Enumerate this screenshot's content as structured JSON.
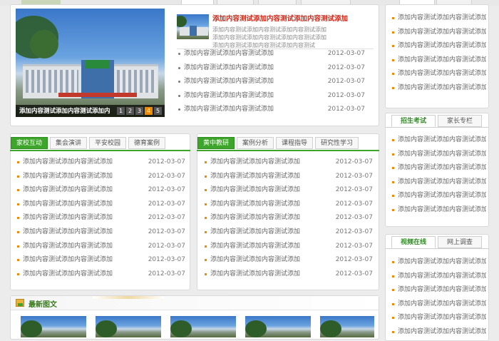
{
  "top_banner": {
    "tabs_left": [
      "",
      ""
    ],
    "tabs_mid": [
      "",
      "",
      "",
      ""
    ],
    "tabs_right": [
      "",
      ""
    ]
  },
  "news": {
    "slide_caption": "添加内容测试添加内容测试添加内",
    "slide_pages": [
      "1",
      "2",
      "3",
      "4",
      "5"
    ],
    "active_page": "4",
    "headline": "添加内容测试添加内容测试添加内容测试添加",
    "summary": [
      "添加内容测试添加内容测试添加内容测试添加",
      "添加内容测试添加内容测试添加内容测试添加",
      "添加内容测试添加内容测试添加内容测试"
    ],
    "items": [
      {
        "text": "添加内容测试添加内容测试添加",
        "date": "2012-03-07"
      },
      {
        "text": "添加内容测试添加内容测试添加",
        "date": "2012-03-07"
      },
      {
        "text": "添加内容测试添加内容测试添加",
        "date": "2012-03-07"
      },
      {
        "text": "添加内容测试添加内容测试添加",
        "date": "2012-03-07"
      },
      {
        "text": "添加内容测试添加内容测试添加",
        "date": "2012-03-07"
      }
    ]
  },
  "home_school": {
    "tabs": [
      "家校互动",
      "集会演讲",
      "平安校园",
      "德育案例"
    ],
    "items": [
      {
        "text": "添加内容测试添加内容测试添加",
        "date": "2012-03-07"
      },
      {
        "text": "添加内容测试添加内容测试添加",
        "date": "2012-03-07"
      },
      {
        "text": "添加内容测试添加内容测试添加",
        "date": "2012-03-07"
      },
      {
        "text": "添加内容测试添加内容测试添加",
        "date": "2012-03-07"
      },
      {
        "text": "添加内容测试添加内容测试添加",
        "date": "2012-03-07"
      },
      {
        "text": "添加内容测试添加内容测试添加",
        "date": "2012-03-07"
      },
      {
        "text": "添加内容测试添加内容测试添加",
        "date": "2012-03-07"
      },
      {
        "text": "添加内容测试添加内容测试添加",
        "date": "2012-03-07"
      },
      {
        "text": "添加内容测试添加内容测试添加",
        "date": "2012-03-07"
      }
    ]
  },
  "teaching": {
    "tabs": [
      "黄中教研",
      "案例分析",
      "课程指导",
      "研究性学习"
    ],
    "items": [
      {
        "text": "添加内容测试添加内容测试添加",
        "date": "2012-03-07"
      },
      {
        "text": "添加内容测试添加内容测试添加",
        "date": "2012-03-07"
      },
      {
        "text": "添加内容测试添加内容测试添加",
        "date": "2012-03-07"
      },
      {
        "text": "添加内容测试添加内容测试添加",
        "date": "2012-03-07"
      },
      {
        "text": "添加内容测试添加内容测试添加",
        "date": "2012-03-07"
      },
      {
        "text": "添加内容测试添加内容测试添加",
        "date": "2012-03-07"
      },
      {
        "text": "添加内容测试添加内容测试添加",
        "date": "2012-03-07"
      },
      {
        "text": "添加内容测试添加内容测试添加",
        "date": "2012-03-07"
      },
      {
        "text": "添加内容测试添加内容测试添加",
        "date": "2012-03-07"
      }
    ]
  },
  "side_top": {
    "items": [
      "添加内容测试添加内容测试添加",
      "添加内容测试添加内容测试添加",
      "添加内容测试添加内容测试添加",
      "添加内容测试添加内容测试添加",
      "添加内容测试添加内容测试添加",
      "添加内容测试添加内容测试添加"
    ]
  },
  "admissions": {
    "tabs": [
      "招生考试",
      "家长专栏"
    ],
    "items": [
      "添加内容测试添加内容测试添加",
      "添加内容测试添加内容测试添加",
      "添加内容测试添加内容测试添加",
      "添加内容测试添加内容测试添加",
      "添加内容测试添加内容测试添加",
      "添加内容测试添加内容测试添加"
    ]
  },
  "video": {
    "tabs": [
      "视频在线",
      "网上调查"
    ],
    "items": [
      "添加内容测试添加内容测试添加",
      "添加内容测试添加内容测试添加",
      "添加内容测试添加内容测试添加",
      "添加内容测试添加内容测试添加",
      "添加内容测试添加内容测试添加",
      "添加内容测试添加内容测试添加"
    ]
  },
  "latest_images": {
    "title": "最新图文"
  },
  "colors": {
    "accent": "#3ea52b",
    "headline": "#cc2a1b",
    "bullet": "#f08a00"
  }
}
